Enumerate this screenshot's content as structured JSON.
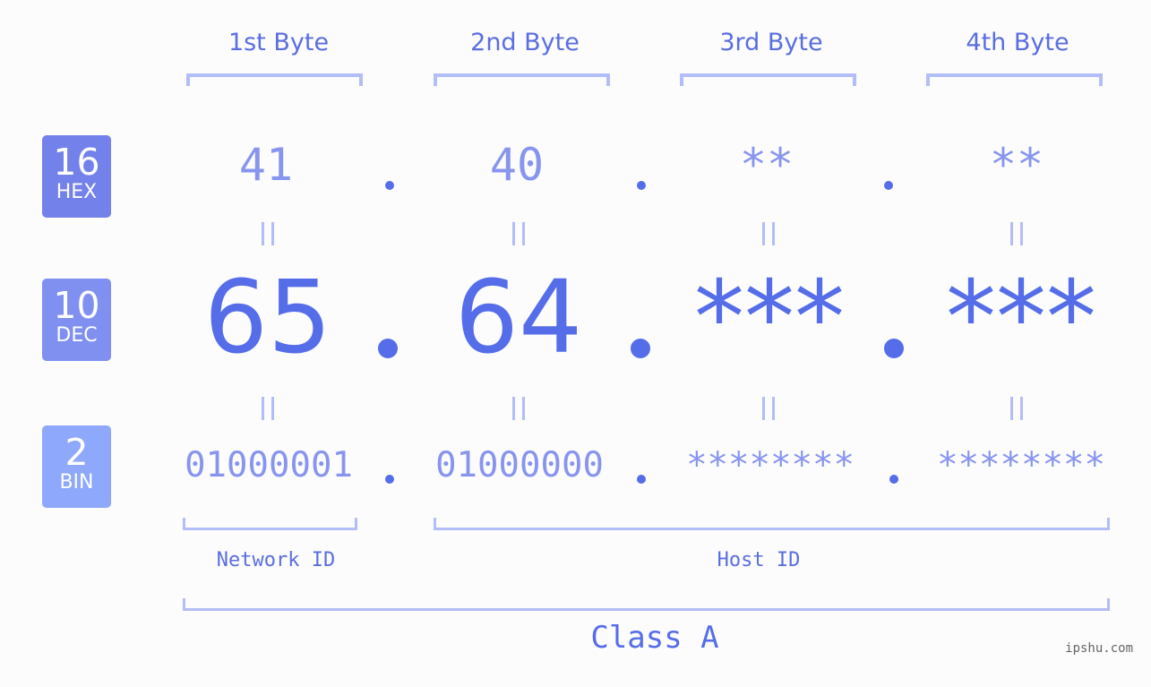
{
  "badges": [
    {
      "number": "16",
      "label": "HEX",
      "color": "#7381ea"
    },
    {
      "number": "10",
      "label": "DEC",
      "color": "#8090f0"
    },
    {
      "number": "2",
      "label": "BIN",
      "color": "#8ea8fb"
    }
  ],
  "bytes": [
    {
      "title": "1st Byte",
      "hex": "41",
      "dec": "65",
      "bin": "01000001"
    },
    {
      "title": "2nd Byte",
      "hex": "40",
      "dec": "64",
      "bin": "01000000"
    },
    {
      "title": "3rd Byte",
      "hex": "**",
      "dec": "***",
      "bin": "********"
    },
    {
      "title": "4th Byte",
      "hex": "**",
      "dec": "***",
      "bin": "********"
    }
  ],
  "network_id_label": "Network ID",
  "host_id_label": "Host ID",
  "class_label": "Class A",
  "watermark": "ipshu.com",
  "colors": {
    "primary": "#556de9",
    "secondary": "#8895ef",
    "bracket": "#b3bdf7",
    "label": "#5a6ee0"
  }
}
